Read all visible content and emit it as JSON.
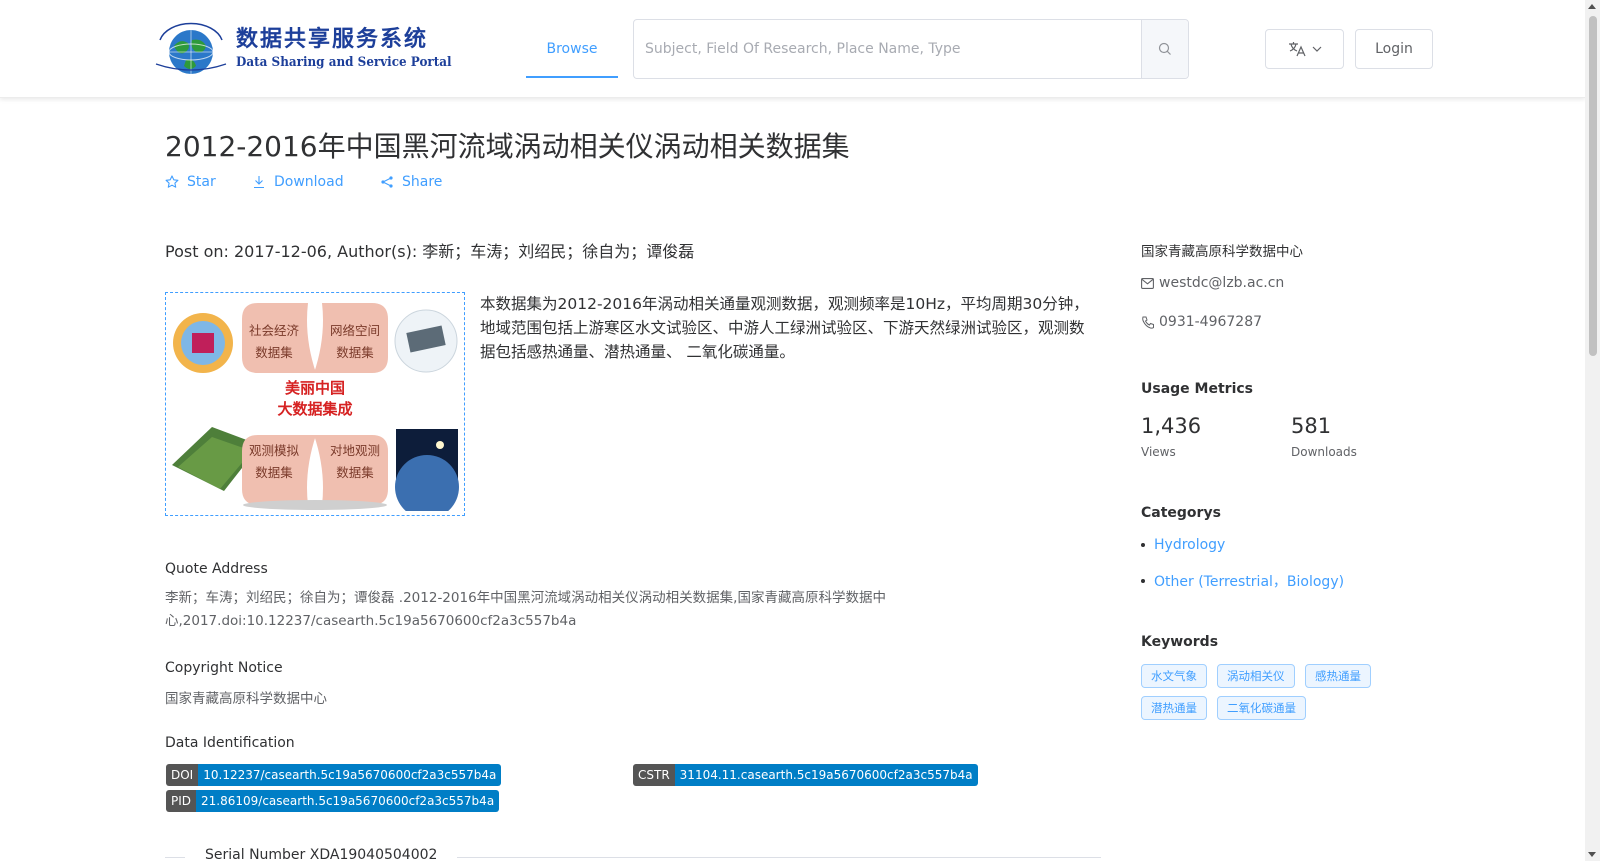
{
  "header": {
    "logo_cn": "数据共享服务系统",
    "logo_en": "Data Sharing and Service Portal",
    "nav_browse": "Browse",
    "search_placeholder": "Subject, Field Of Research, Place Name, Type",
    "login_label": "Login"
  },
  "dataset": {
    "title": "2012-2016年中国黑河流域涡动相关仪涡动相关数据集",
    "actions": {
      "star": "Star",
      "download": "Download",
      "share": "Share"
    },
    "post_line": "Post on: 2017-12-06, Author(s): 李新；车涛；刘绍民；徐自为；谭俊磊",
    "thumbnail": {
      "cells": [
        "社会经济\n数据集",
        "网络空间\n数据集",
        "观测模拟\n数据集",
        "对地观测\n数据集"
      ],
      "center": "美丽中国\n大数据集成"
    },
    "description": "本数据集为2012-2016年涡动相关通量观测数据，观测频率是10Hz，平均周期30分钟，地域范围包括上游寒区水文试验区、中游人工绿洲试验区、下游天然绿洲试验区，观测数据包括感热通量、潜热通量、 二氧化碳通量。",
    "quote_label": "Quote Address",
    "quote_text": "李新；车涛；刘绍民；徐自为；谭俊磊 .2012-2016年中国黑河流域涡动相关仪涡动相关数据集,国家青藏高原科学数据中心,2017.doi:10.12237/casearth.5c19a5670600cf2a3c557b4a",
    "copyright_label": "Copyright Notice",
    "copyright_text": "国家青藏高原科学数据中心",
    "identification_label": "Data Identification",
    "identifiers": {
      "doi": {
        "key": "DOI",
        "value": "10.12237/casearth.5c19a5670600cf2a3c557b4a"
      },
      "cstr": {
        "key": "CSTR",
        "value": "31104.11.casearth.5c19a5670600cf2a3c557b4a"
      },
      "pid": {
        "key": "PID",
        "value": "21.86109/casearth.5c19a5670600cf2a3c557b4a"
      }
    },
    "serial": "Serial Number XDA19040504002"
  },
  "sidebar": {
    "org": "国家青藏高原科学数据中心",
    "email": "westdc@lzb.ac.cn",
    "phone": "0931-4967287",
    "usage_heading": "Usage Metrics",
    "views_num": "1,436",
    "views_label": "Views",
    "downloads_num": "581",
    "downloads_label": "Downloads",
    "categories_heading": "Categorys",
    "categories": [
      "Hydrology",
      "Other (Terrestrial，Biology)"
    ],
    "keywords_heading": "Keywords",
    "keywords": [
      "水文气象",
      "涡动相关仪",
      "感热通量",
      "潜热通量",
      "二氧化碳通量"
    ]
  },
  "colors": {
    "accent": "#409eff",
    "doi_value_bg": "#007ec6",
    "doi_key_bg": "#555555"
  }
}
